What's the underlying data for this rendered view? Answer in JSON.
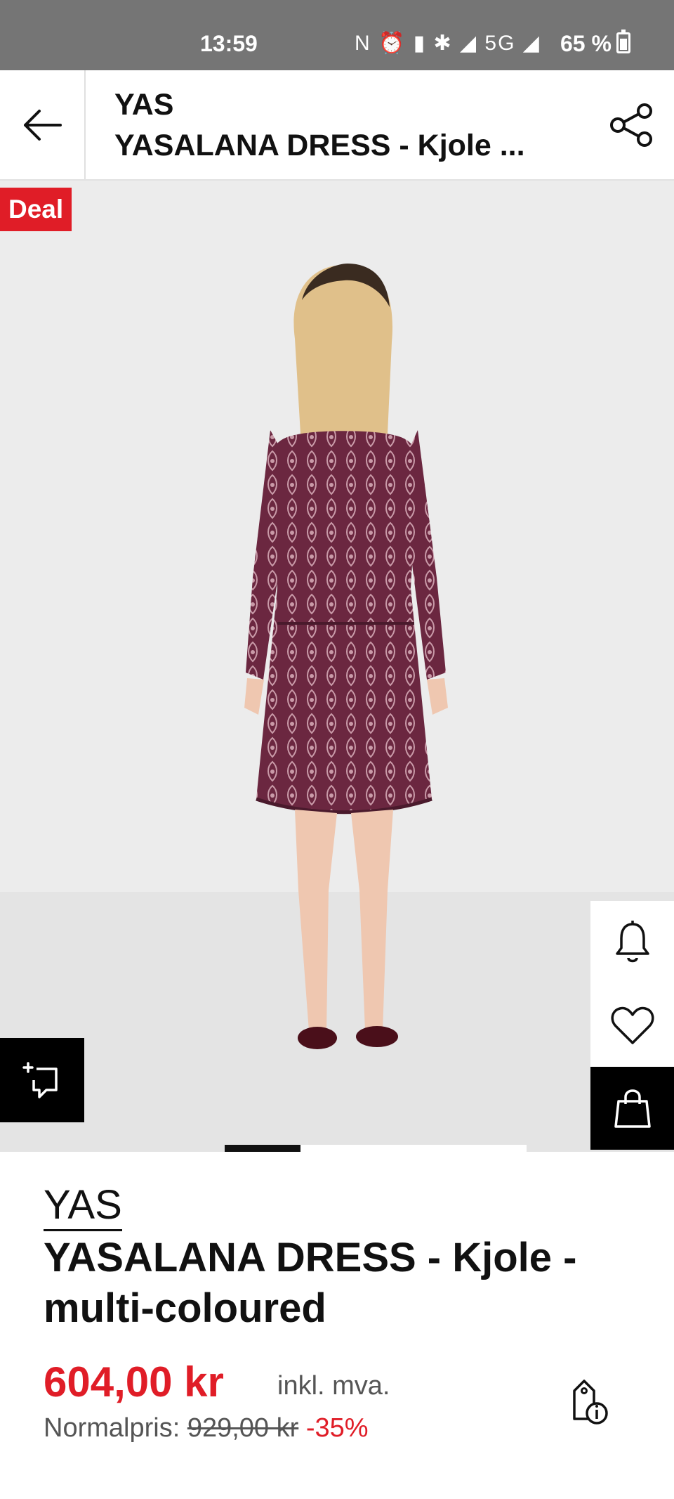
{
  "status_bar": {
    "time": "13:59",
    "icons": "N ⏰ ▮ ✱ ◢ 5G ◢",
    "battery": "65 %",
    "battery_level": 0.65
  },
  "header": {
    "brand": "YAS",
    "title": "YASALANA DRESS - Kjole ..."
  },
  "gallery": {
    "badge": "Deal",
    "active_image_index": 0,
    "image_count": 4
  },
  "product": {
    "brand": "YAS",
    "name": "YASALANA DRESS - Kjole - multi-coloured",
    "price": "604,00 kr",
    "vat_note": "inkl. mva.",
    "normal_label": "Normalpris:",
    "normal_price": "929,00 kr",
    "discount": "-35%"
  },
  "colors": {
    "deal_red": "#e01d27",
    "dress": "#6b2740"
  },
  "icons": [
    "back-arrow-icon",
    "share-icon",
    "compare-icon",
    "bell-icon",
    "heart-icon",
    "shopping-bag-icon",
    "price-info-icon"
  ]
}
